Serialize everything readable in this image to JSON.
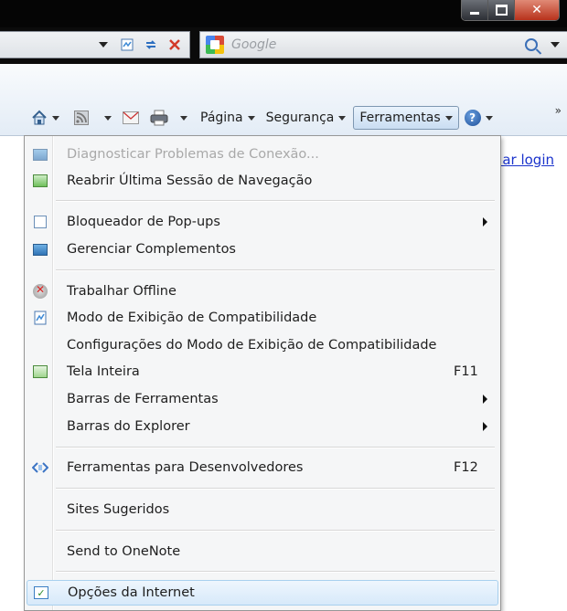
{
  "window": {
    "buttons": [
      "minimize",
      "maximize",
      "close"
    ]
  },
  "search": {
    "placeholder": "Google"
  },
  "commandbar": {
    "items": [
      {
        "label": "Página",
        "icon": "page-icon"
      },
      {
        "label": "Segurança",
        "icon": "safety-icon"
      },
      {
        "label": "Ferramentas",
        "icon": "tools-icon"
      }
    ],
    "help_icon": "help-icon",
    "overflow": "»"
  },
  "page": {
    "login_link": "iar login"
  },
  "menu": {
    "items": [
      {
        "label": "Diagnosticar Problemas de Conexão...",
        "disabled": true,
        "icon": "diagnose-icon"
      },
      {
        "label": "Reabrir Última Sessão de Navegação",
        "icon": "reopen-session-icon"
      },
      {
        "label": "Bloqueador de Pop-ups",
        "submenu": true,
        "icon": "popup-blocker-icon"
      },
      {
        "label": "Gerenciar Complementos",
        "icon": "addons-icon"
      },
      {
        "label": "Trabalhar Offline",
        "icon": "offline-icon"
      },
      {
        "label": "Modo de Exibição de Compatibilidade",
        "icon": "compatibility-icon"
      },
      {
        "label": "Configurações do Modo de Exibição de Compatibilidade"
      },
      {
        "label": "Tela Inteira",
        "shortcut": "F11",
        "icon": "fullscreen-icon"
      },
      {
        "label": "Barras de Ferramentas",
        "submenu": true
      },
      {
        "label": "Barras do Explorer",
        "submenu": true
      },
      {
        "label": "Ferramentas para Desenvolvedores",
        "shortcut": "F12",
        "icon": "developer-tools-icon"
      },
      {
        "label": "Sites Sugeridos"
      },
      {
        "label": "Send to OneNote"
      },
      {
        "label": "Opções da Internet",
        "highlighted": true,
        "icon": "internet-options-icon"
      }
    ]
  },
  "colors": {
    "link": "#1a33cc",
    "menu_highlight": "#d7e9fa",
    "disabled_text": "#a9a9a9"
  }
}
